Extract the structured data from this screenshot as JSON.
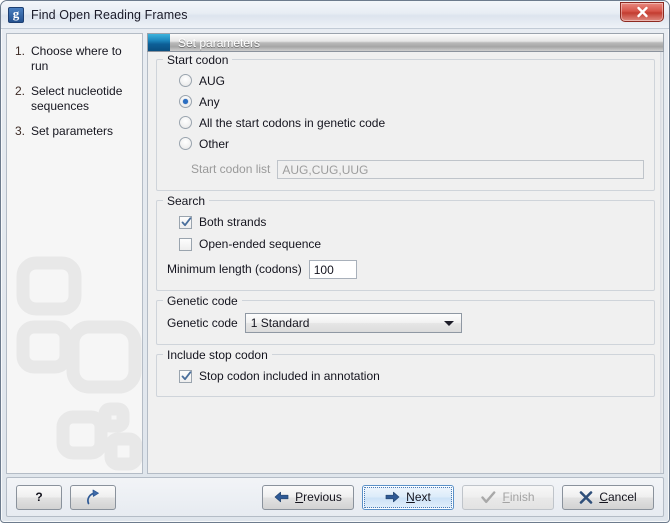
{
  "window": {
    "title": "Find Open Reading Frames",
    "app_icon": "clc-workbench-icon",
    "close_label": "Close"
  },
  "sidebar": {
    "steps": [
      {
        "num": "1.",
        "label": "Choose where to run"
      },
      {
        "num": "2.",
        "label": "Select nucleotide sequences"
      },
      {
        "num": "3.",
        "label": "Set parameters"
      }
    ]
  },
  "panel": {
    "header_title": "Set parameters"
  },
  "start_codon": {
    "title": "Start codon",
    "options": [
      {
        "label": "AUG",
        "checked": false
      },
      {
        "label": "Any",
        "checked": true
      },
      {
        "label": "All the start codons in genetic code",
        "checked": false
      },
      {
        "label": "Other",
        "checked": false
      }
    ],
    "codon_list_label": "Start codon list",
    "codon_list_value": "AUG,CUG,UUG",
    "codon_list_disabled": true
  },
  "search": {
    "title": "Search",
    "both_strands_label": "Both strands",
    "both_strands_checked": true,
    "open_ended_label": "Open-ended sequence",
    "open_ended_checked": false,
    "min_length_label": "Minimum length (codons)",
    "min_length_value": "100"
  },
  "genetic_code": {
    "title": "Genetic code",
    "field_label": "Genetic code",
    "selected": "1 Standard"
  },
  "include_stop_codon": {
    "title": "Include stop codon",
    "checkbox_label": "Stop codon included in annotation",
    "checked": true
  },
  "footer": {
    "help_label": "?",
    "reset_label": "reset-icon",
    "previous_label": "Previous",
    "previous_mnemonic": "P",
    "next_label": "Next",
    "next_mnemonic": "N",
    "finish_label": "Finish",
    "finish_mnemonic": "F",
    "finish_disabled": true,
    "cancel_label": "Cancel",
    "cancel_mnemonic": "C"
  },
  "colors": {
    "header_accent": "#1d86bd",
    "radio_dot": "#2a6ec2",
    "check_mark": "#4a6f9c",
    "close_red": "#c33c30",
    "focus_blue": "#5b91c8"
  }
}
